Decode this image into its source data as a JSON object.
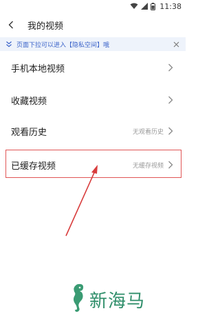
{
  "status_bar": {
    "time": "11:38"
  },
  "header": {
    "title": "我的视频"
  },
  "notice": {
    "text": "页面下拉可以进入【隐私空间】哦"
  },
  "menu": {
    "items": [
      {
        "label": "手机本地视频",
        "value": ""
      },
      {
        "label": "收藏视频",
        "value": ""
      },
      {
        "label": "观看历史",
        "value": "无观看历史"
      },
      {
        "label": "已缓存视频",
        "value": "无缓存视频"
      }
    ]
  },
  "watermark": {
    "text": "新海马"
  },
  "colors": {
    "accent": "#3b63c9",
    "notice_bg": "#eef3fb",
    "highlight": "#e05555",
    "watermark": "#2f8e6a"
  },
  "icons": {
    "back": "back-icon",
    "notice": "double-chevron-down-icon",
    "close": "close-icon",
    "item": "chevron-right-icon"
  }
}
